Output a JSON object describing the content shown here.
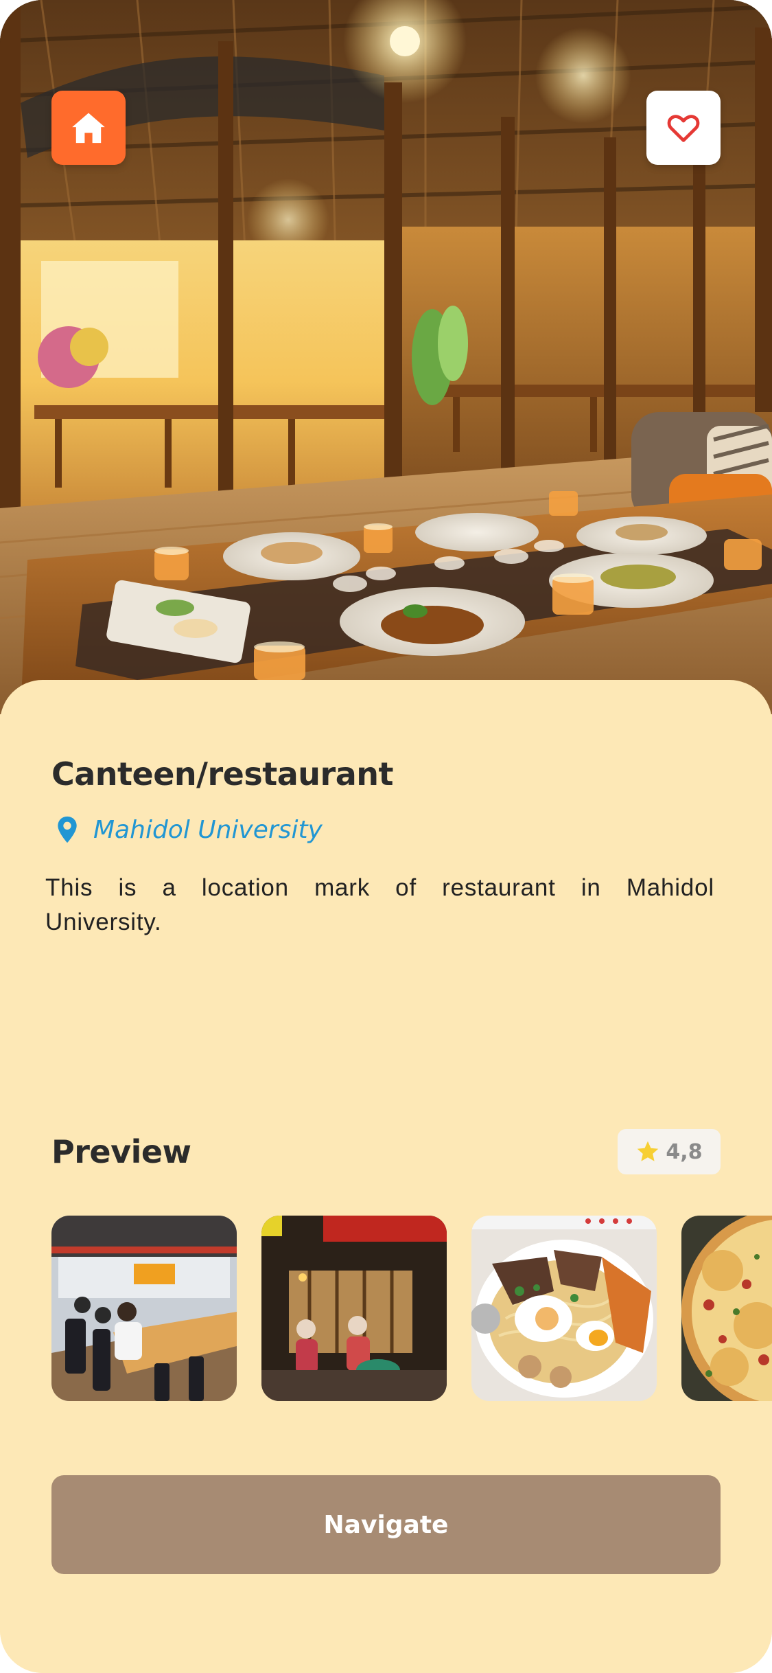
{
  "place": {
    "title": "Canteen/restaurant",
    "location": "Mahidol University",
    "description": "This is a location mark of restaurant in Mahidol University."
  },
  "preview": {
    "title": "Preview",
    "rating": "4,8"
  },
  "actions": {
    "navigate_label": "Navigate"
  },
  "icons": {
    "home": "home-icon",
    "favorite": "heart-outline-icon",
    "location": "location-pin-icon",
    "rating": "star-icon"
  },
  "colors": {
    "background": "#fde8b6",
    "home_button": "#ff6b2c",
    "heart": "#e53935",
    "location_accent": "#2196d3",
    "star": "#f7cf33",
    "navigate_button": "#a78b73",
    "title_text": "#2b2b2b"
  }
}
